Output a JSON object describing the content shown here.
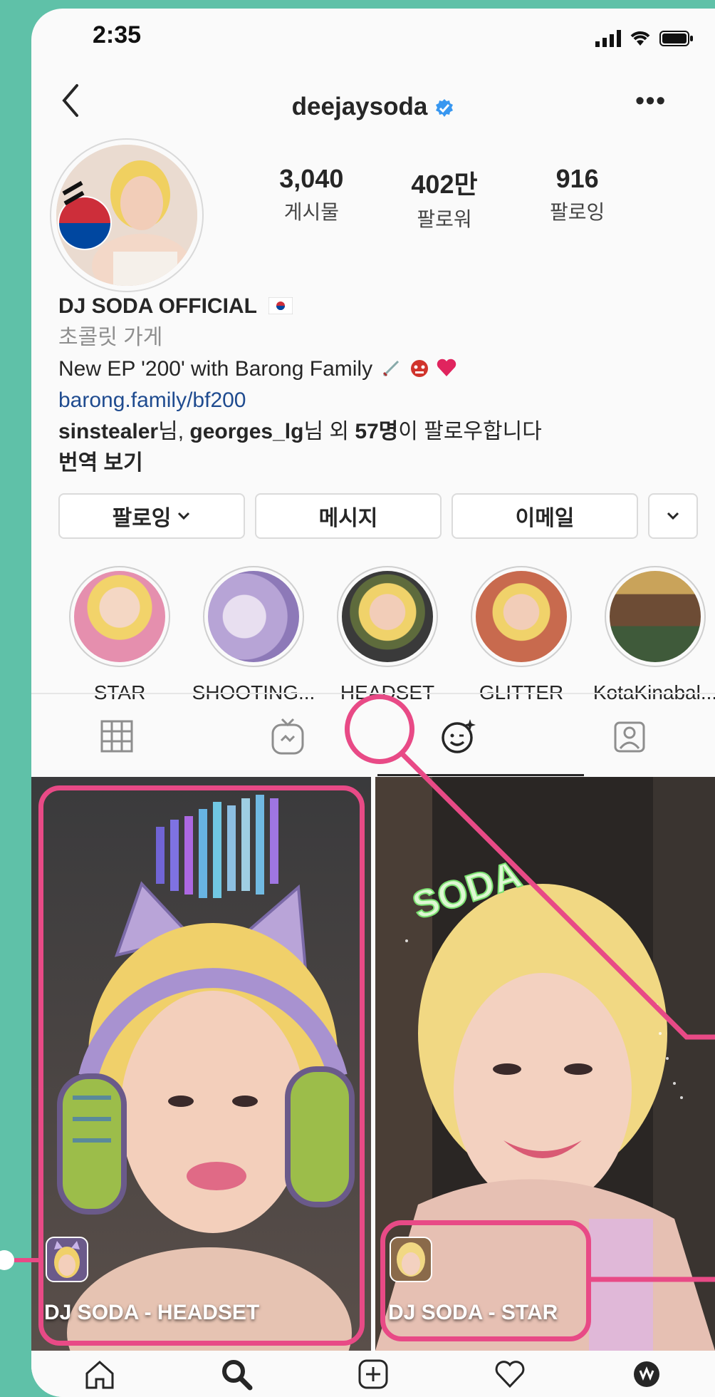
{
  "status": {
    "time": "2:35"
  },
  "header": {
    "username": "deejaysoda"
  },
  "stats": [
    {
      "value": "3,040",
      "label": "게시물"
    },
    {
      "value": "402만",
      "label": "팔로워"
    },
    {
      "value": "916",
      "label": "팔로잉"
    }
  ],
  "bio": {
    "name": "DJ SODA OFFICIAL",
    "category": "초콜릿 가게",
    "line": "New EP '200' with Barong Family",
    "link": "barong.family/bf200",
    "followed_user1": "sinstealer",
    "followed_mid": "님, ",
    "followed_user2": "georges_lg",
    "followed_text1": "님 외 ",
    "followed_count": "57명",
    "followed_text2": "이 팔로우합니다",
    "translate": "번역 보기"
  },
  "buttons": {
    "following": "팔로잉",
    "message": "메시지",
    "email": "이메일"
  },
  "highlights": [
    {
      "label": "STAR"
    },
    {
      "label": "SHOOTING..."
    },
    {
      "label": "HEADSET"
    },
    {
      "label": "GLITTER"
    },
    {
      "label": "KotaKinabal..."
    }
  ],
  "tiles": [
    {
      "label": "DJ SODA - HEADSET"
    },
    {
      "label": "DJ SODA - STAR"
    }
  ],
  "colors": {
    "accent": "#e84a86",
    "background": "#5fc1a8",
    "verified": "#3897f0"
  },
  "icons": [
    "back-icon",
    "verified-icon",
    "more-icon",
    "grid-icon",
    "igtv-icon",
    "effects-icon",
    "tagged-icon",
    "home-icon",
    "search-icon",
    "add-icon",
    "heart-icon",
    "profile-icon"
  ]
}
